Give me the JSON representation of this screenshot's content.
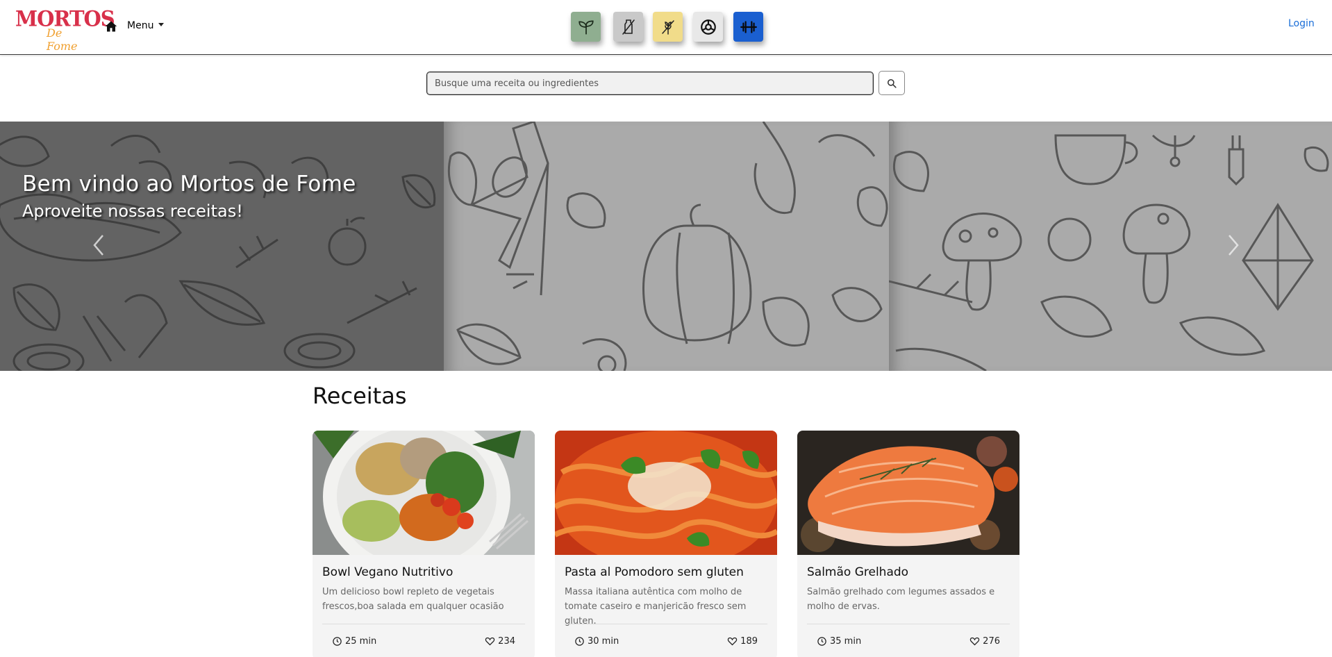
{
  "header": {
    "logo_main": "MORTOS",
    "logo_script": "De Fome",
    "menu_label": "Menu",
    "login_label": "Login",
    "filters": [
      {
        "icon": "sprout-icon",
        "color": "#8fae90"
      },
      {
        "icon": "no-dairy-icon",
        "color": "#c9c9c9"
      },
      {
        "icon": "gluten-free-icon",
        "color": "#f1dc8a"
      },
      {
        "icon": "fitness-icon",
        "color": "#e8e8e8"
      },
      {
        "icon": "dumbbell-icon",
        "color": "#1a5fd0"
      }
    ]
  },
  "search": {
    "placeholder": "Busque uma receita ou ingredientes"
  },
  "carousel": {
    "title": "Bem vindo ao Mortos de Fome",
    "subtitle": "Aproveite nossas receitas!"
  },
  "recipes": {
    "heading": "Receitas",
    "items": [
      {
        "title": "Bowl Vegano Nutritivo",
        "description": "Um delicioso bowl repleto de vegetais frescos,boa salada em qualquer ocasião",
        "time": "25 min",
        "likes": "234"
      },
      {
        "title": "Pasta al Pomodoro sem gluten",
        "description": "Massa italiana autêntica com molho de tomate caseiro e manjericão fresco sem gluten.",
        "time": "30 min",
        "likes": "189"
      },
      {
        "title": "Salmão Grelhado",
        "description": "Salmão grelhado com legumes assados e molho de ervas.",
        "time": "35 min",
        "likes": "276"
      }
    ]
  },
  "colors": {
    "brand_red": "#d8304a",
    "brand_orange": "#f0a030",
    "link_blue": "#1a6ed8"
  }
}
